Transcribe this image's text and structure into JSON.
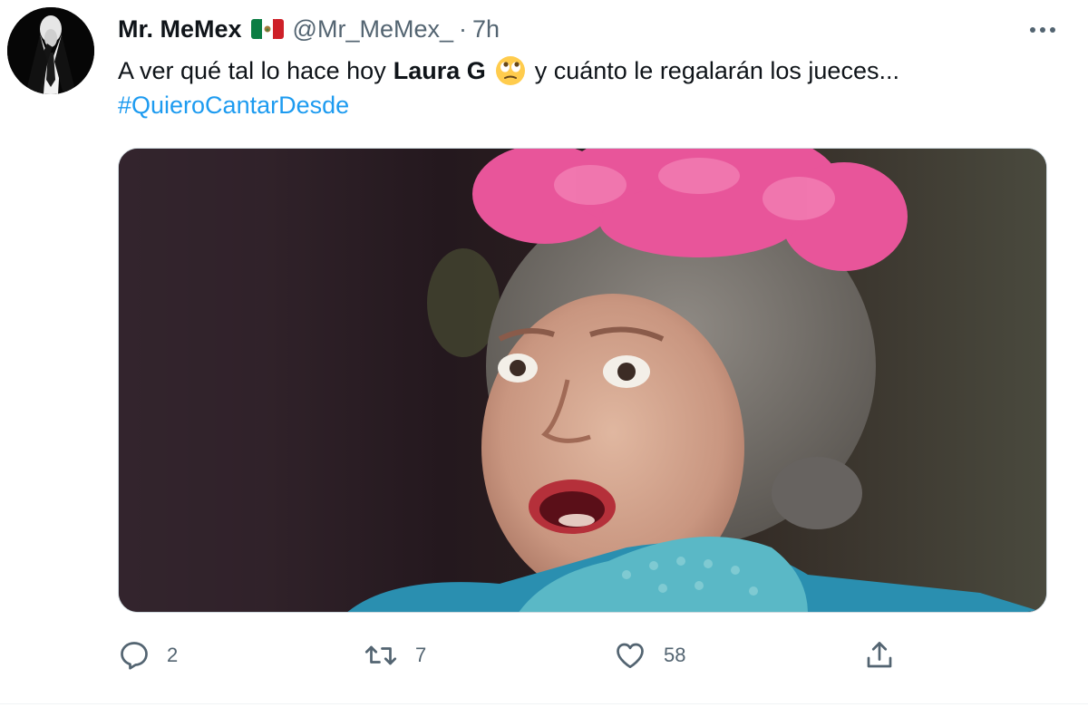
{
  "tweet": {
    "display_name": "Mr. MeMex",
    "handle": "@Mr_MeMex_",
    "separator": "·",
    "time": "7h",
    "text_before": "A ver qué tal lo hace hoy",
    "mention": "Laura G",
    "text_after": "y cuánto le regalarán los jueces...",
    "hashtag": "#QuieroCantarDesde",
    "flag_icon": "mexico-flag-icon",
    "emoji_icon": "face-with-rolling-eyes-emoji"
  },
  "actions": {
    "reply_count": "2",
    "retweet_count": "7",
    "like_count": "58"
  },
  "colors": {
    "link": "#1d9bf0",
    "secondary_text": "#536471",
    "primary_text": "#0f1419"
  }
}
